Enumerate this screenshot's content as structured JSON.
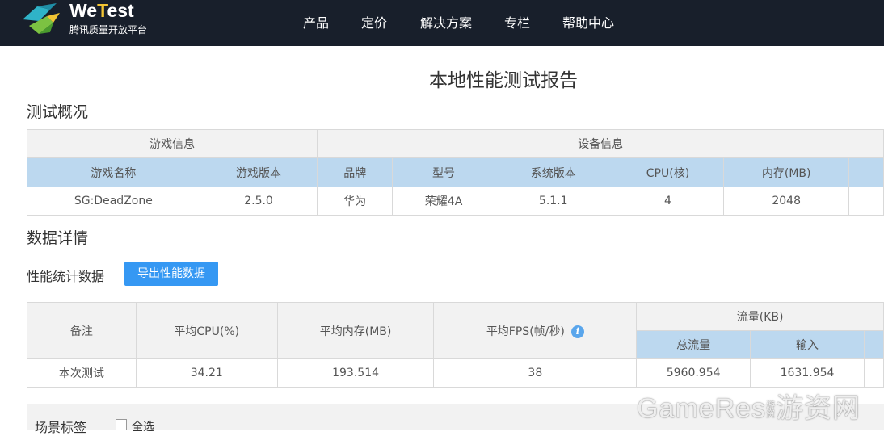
{
  "header": {
    "logo_name_we": "We",
    "logo_name_t": "T",
    "logo_name_rest": "est",
    "logo_subtitle": "腾讯质量开放平台",
    "nav": [
      "产品",
      "定价",
      "解决方案",
      "专栏",
      "帮助中心"
    ]
  },
  "page_title": "本地性能测试报告",
  "overview": {
    "title": "测试概况",
    "game_group": "游戏信息",
    "device_group": "设备信息",
    "headers": [
      "游戏名称",
      "游戏版本",
      "品牌",
      "型号",
      "系统版本",
      "CPU(核)",
      "内存(MB)"
    ],
    "values": [
      "SG:DeadZone",
      "2.5.0",
      "华为",
      "荣耀4A",
      "5.1.1",
      "4",
      "2048"
    ]
  },
  "details": {
    "title": "数据详情",
    "perf_label": "性能统计数据",
    "export_button": "导出性能数据",
    "headers": {
      "note": "备注",
      "avg_cpu": "平均CPU(%)",
      "avg_mem": "平均内存(MB)",
      "avg_fps": "平均FPS(帧/秒)",
      "traffic": "流量(KB)",
      "traffic_total": "总流量",
      "traffic_in": "输入"
    },
    "row": {
      "note": "本次测试",
      "avg_cpu": "34.21",
      "avg_mem": "193.514",
      "avg_fps": "38",
      "traffic_total": "5960.954",
      "traffic_in": "1631.954"
    }
  },
  "scene": {
    "label": "场景标签",
    "select_all": "全选"
  },
  "watermark": {
    "text": "GameRes",
    "small": "游资",
    "cn": "游资网"
  },
  "colors": {
    "nav_bg": "#181f2b",
    "accent_yellow": "#f2c433",
    "header_blue": "#bcd8ef",
    "button_blue": "#3598f3",
    "grey": "#f2f2f2"
  }
}
